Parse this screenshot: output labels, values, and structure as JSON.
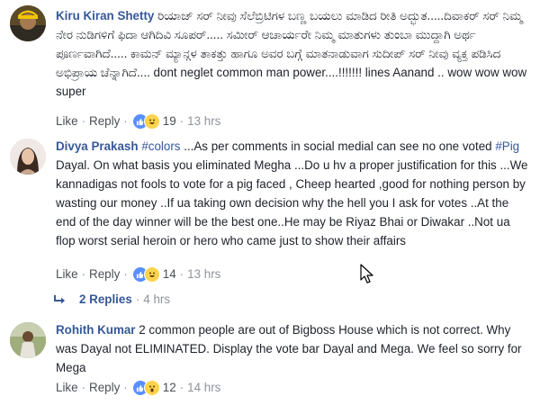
{
  "comments": [
    {
      "author": "Kiru Kiran Shetty",
      "text": "ರಿಯಾಜ್ ಸರ್ ನೀವು ಸೆಲೆಬ್ರಿಟಿಗಳ ಬಣ್ಣ ಬಯಲು ಮಾಡಿದ ರೀತಿ ಅದ್ಭುತ.....ದಿವಾಕರ್ ಸರ್ ನಿಮ್ಮ ನೇರ ನುಡಿಗಳಿಗೆ ಫಿದಾ ಆಗಿದಿವಿ ಸೂಪರ್..... ಸಮೀರ್ ಆಚಾರ್ಯರೇ ನಿಮ್ಮ ಮಾತುಗಳು ತುಂಬಾ ಮುದ್ದಾಗಿ ಅರ್ಥ ಪೂರ್ಣವಾಗಿದೆ..... ಕಾಮನ್ ಮ್ಯಾನ್ಗಳ ತಾಕತ್ತು ಹಾಗೂ ಅವರ ಬಗ್ಗೆ ಮಾತನಾಡುವಾಗ ಸುದೀಪ್ ಸರ್ ನೀವು ವ್ಯಕ್ತ ಪಡಿಸಿದ ಅಭಿಪ್ರಾಯ ಚೆನ್ನಾಗಿದೆ.... dont neglet common man power....!!!!!!! lines Aanand .. wow wow wow super",
      "like": "Like",
      "reply": "Reply",
      "reactions": "19",
      "time": "13 hrs"
    },
    {
      "author": "Divya Prakash",
      "hashtag": "#colors",
      "text_a": " ...As per comments in social medial can see no one voted ",
      "hashtag2": "#Pig",
      "text_b": " Dayal. On what basis you eliminated Megha ...Do u hv a proper justification for this ...We kannadigas not fools to vote for a pig faced , Cheep hearted ,good for nothing person by wasting our money ..If ua taking own decision why the hell you I ask for votes ..At the end of the day winner will be the best one..He may be Riyaz Bhai or Diwakar ..Not ua flop worst serial heroin or hero who came just to show their affairs",
      "like": "Like",
      "reply": "Reply",
      "reactions": "14",
      "time": "13 hrs",
      "replies_label": "2 Replies",
      "replies_time": "4 hrs"
    },
    {
      "author": "Rohith Kumar",
      "text": " 2 common people are out of Bigboss House which is not correct. Why was Dayal not ELIMINATED. Display the vote bar Dayal and Mega. We feel so sorry for Mega",
      "like": "Like",
      "reply": "Reply",
      "reactions": "12",
      "time": "14 hrs"
    }
  ],
  "colors": {
    "name": "#365899",
    "text": "#1d2129",
    "meta": "#90949c"
  }
}
